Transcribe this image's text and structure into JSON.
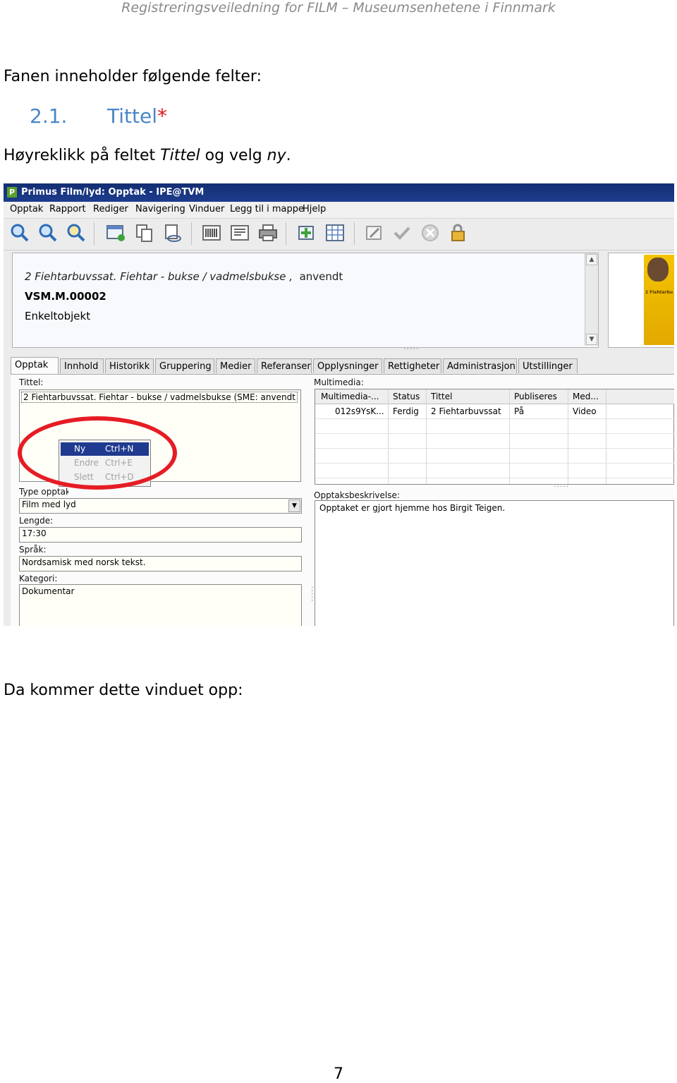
{
  "doc": {
    "header": "Registreringsveiledning for FILM – Museumsenhetene i Finnmark",
    "intro": "Fanen inneholder følgende felter:",
    "section_number": "2.1.",
    "section_title": "Tittel",
    "section_required_mark": "*",
    "instruction_a": "Høyreklikk på feltet ",
    "instruction_field": "Tittel",
    "instruction_b": " og velg ",
    "instruction_choice": "ny",
    "instruction_end": ".",
    "after": "Da kommer dette vinduet opp:",
    "page_number": "7"
  },
  "app": {
    "logo": "P",
    "title": "Primus Film/lyd: Opptak - IPE@TVM",
    "menu": [
      "Opptak",
      "Rapport",
      "Rediger",
      "Navigering",
      "Vinduer",
      "Legg til i mappe",
      "Hjelp"
    ],
    "toolbar_icons": [
      "search-icon",
      "zoom-icon",
      "advanced-search-icon",
      "new-record-icon",
      "copy-icon",
      "link-icon",
      "barcode-icon",
      "label-icon",
      "print-icon",
      "add-icon",
      "grid-icon",
      "edit-icon",
      "check-icon",
      "cancel-icon",
      "lock-icon"
    ],
    "info": {
      "line1": "2 Fiehtarbuvssat. Fiehtar - bukse / vadmelsbukse ,",
      "line1_status": "anvendt",
      "line2": "VSM.M.00002",
      "line3": "Enkeltobjekt"
    },
    "thumbnail_text": "2 Fiehtarbu",
    "tabs": [
      "Opptak",
      "Innhold",
      "Historikk",
      "Gruppering",
      "Medier",
      "Referanser",
      "Opplysninger",
      "Rettigheter",
      "Administrasjon",
      "Utstillinger"
    ],
    "left": {
      "tittel_label": "Tittel:",
      "tittel_value": "2 Fiehtarbuvssat. Fiehtar - bukse / vadmelsbukse (SME: anvendt",
      "context_menu": [
        {
          "label": "Ny",
          "shortcut": "Ctrl+N"
        },
        {
          "label": "Endre",
          "shortcut": "Ctrl+E"
        },
        {
          "label": "Slett",
          "shortcut": "Ctrl+D"
        }
      ],
      "type_label": "Type opptak:",
      "type_value": "Film med lyd",
      "lengde_label": "Lengde:",
      "lengde_value": "17:30",
      "sprak_label": "Språk:",
      "sprak_value": "Nordsamisk med norsk tekst.",
      "kategori_label": "Kategori:",
      "kategori_value": "Dokumentar"
    },
    "right": {
      "multimedia_label": "Multimedia:",
      "columns": [
        "Multimedia-...",
        "Status",
        "Tittel",
        "Publiseres",
        "Med..."
      ],
      "rows": [
        [
          "012s9YsK...",
          "Ferdig",
          "2 Fiehtarbuvssat",
          "På",
          "Video"
        ]
      ],
      "desc_label": "Opptaksbeskrivelse:",
      "desc_value": "Opptaket er gjort hjemme hos Birgit Teigen."
    }
  }
}
